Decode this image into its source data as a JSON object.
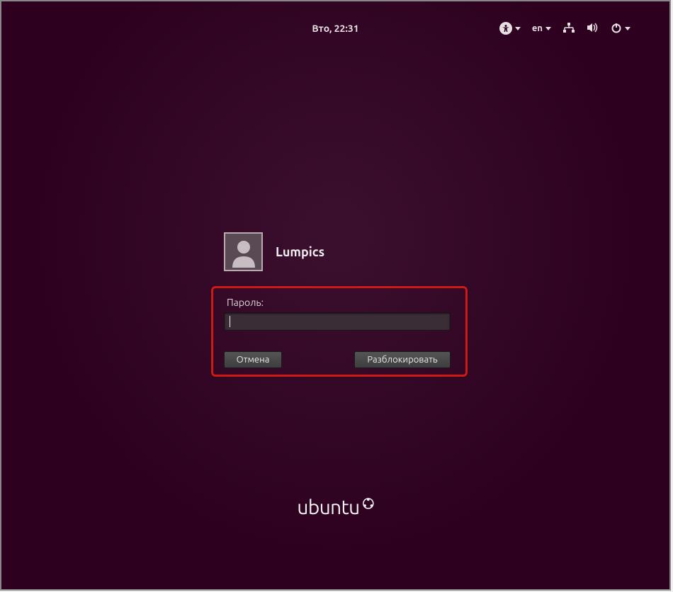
{
  "topbar": {
    "datetime": "Вто, 22:31",
    "language": "en"
  },
  "login": {
    "username": "Lumpics",
    "password_label": "Пароль:",
    "password_value": "",
    "cancel_label": "Отмена",
    "unlock_label": "Разблокировать"
  },
  "branding": {
    "os_name": "ubuntu"
  },
  "icons": {
    "accessibility": "accessibility-icon",
    "network": "network-icon",
    "volume": "volume-icon",
    "power": "power-icon"
  }
}
